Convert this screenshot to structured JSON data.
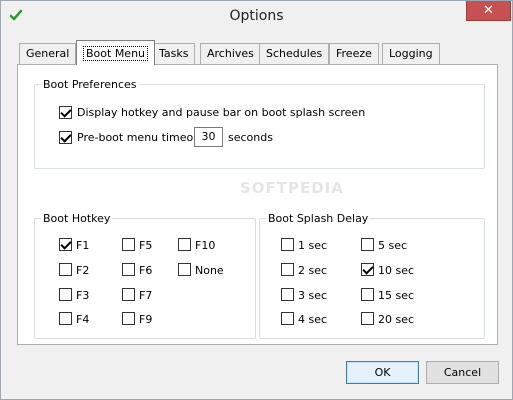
{
  "window": {
    "title": "Options",
    "close_glyph": "✕"
  },
  "tabs": [
    {
      "label": "General",
      "active": false
    },
    {
      "label": "Boot Menu",
      "active": true
    },
    {
      "label": "Tasks",
      "active": false
    },
    {
      "label": "Archives",
      "active": false
    },
    {
      "label": "Schedules",
      "active": false
    },
    {
      "label": "Freeze",
      "active": false
    },
    {
      "label": "Logging",
      "active": false
    }
  ],
  "boot_preferences": {
    "title": "Boot Preferences",
    "display_hotkey": {
      "label": "Display hotkey and pause bar on boot splash screen",
      "checked": true
    },
    "timeout": {
      "label": "Pre-boot menu timeout:",
      "checked": true,
      "value": "30",
      "unit": "seconds"
    }
  },
  "boot_hotkey": {
    "title": "Boot Hotkey",
    "keys": [
      {
        "label": "F1",
        "checked": true
      },
      {
        "label": "F2",
        "checked": false
      },
      {
        "label": "F3",
        "checked": false
      },
      {
        "label": "F4",
        "checked": false
      },
      {
        "label": "F5",
        "checked": false
      },
      {
        "label": "F6",
        "checked": false
      },
      {
        "label": "F7",
        "checked": false
      },
      {
        "label": "F9",
        "checked": false
      },
      {
        "label": "F10",
        "checked": false
      },
      {
        "label": "None",
        "checked": false
      }
    ]
  },
  "boot_splash_delay": {
    "title": "Boot Splash Delay",
    "options": [
      {
        "label": "1 sec",
        "checked": false
      },
      {
        "label": "2 sec",
        "checked": false
      },
      {
        "label": "3 sec",
        "checked": false
      },
      {
        "label": "4 sec",
        "checked": false
      },
      {
        "label": "5 sec",
        "checked": false
      },
      {
        "label": "10 sec",
        "checked": true
      },
      {
        "label": "15 sec",
        "checked": false
      },
      {
        "label": "20 sec",
        "checked": false
      }
    ]
  },
  "buttons": {
    "ok": "OK",
    "cancel": "Cancel"
  },
  "watermark": "SOFTPEDIA",
  "colors": {
    "accent": "#3c7fb1",
    "close_button": "#c75050",
    "app_icon": "#2e9b2e"
  }
}
